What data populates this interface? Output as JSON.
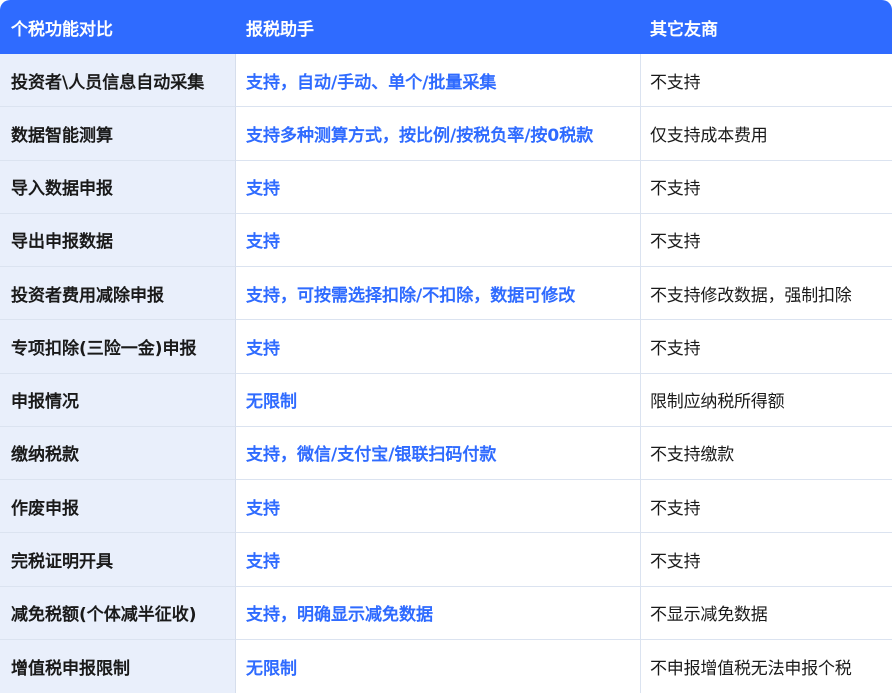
{
  "header": {
    "feature": "个税功能对比",
    "ours": "报税助手",
    "others": "其它友商"
  },
  "rows": [
    {
      "feature": "投资者\\人员信息自动采集",
      "ours": "支持，自动/手动、单个/批量采集",
      "others": "不支持"
    },
    {
      "feature": "数据智能测算",
      "ours": "支持多种测算方式，按比例/按税负率/按0税款",
      "others": "仅支持成本费用"
    },
    {
      "feature": "导入数据申报",
      "ours": "支持",
      "others": "不支持"
    },
    {
      "feature": "导出申报数据",
      "ours": "支持",
      "others": "不支持"
    },
    {
      "feature": "投资者费用减除申报",
      "ours": "支持，可按需选择扣除/不扣除，数据可修改",
      "others": "不支持修改数据，强制扣除"
    },
    {
      "feature": "专项扣除(三险一金)申报",
      "ours": "支持",
      "others": "不支持"
    },
    {
      "feature": "申报情况",
      "ours": "无限制",
      "others": "限制应纳税所得额"
    },
    {
      "feature": "缴纳税款",
      "ours": "支持，微信/支付宝/银联扫码付款",
      "others": "不支持缴款"
    },
    {
      "feature": "作废申报",
      "ours": "支持",
      "others": "不支持"
    },
    {
      "feature": "完税证明开具",
      "ours": "支持",
      "others": "不支持"
    },
    {
      "feature": "减免税额(个体减半征收)",
      "ours": "支持，明确显示减免数据",
      "others": "不显示减免数据"
    },
    {
      "feature": "增值税申报限制",
      "ours": "无限制",
      "others": "不申报增值税无法申报个税"
    }
  ],
  "colors": {
    "header_bg": "#2f6bff",
    "feature_bg": "#e9effb",
    "accent_text": "#2f6bff",
    "body_text": "#1a1a1a",
    "divider": "#dbe3f0"
  }
}
